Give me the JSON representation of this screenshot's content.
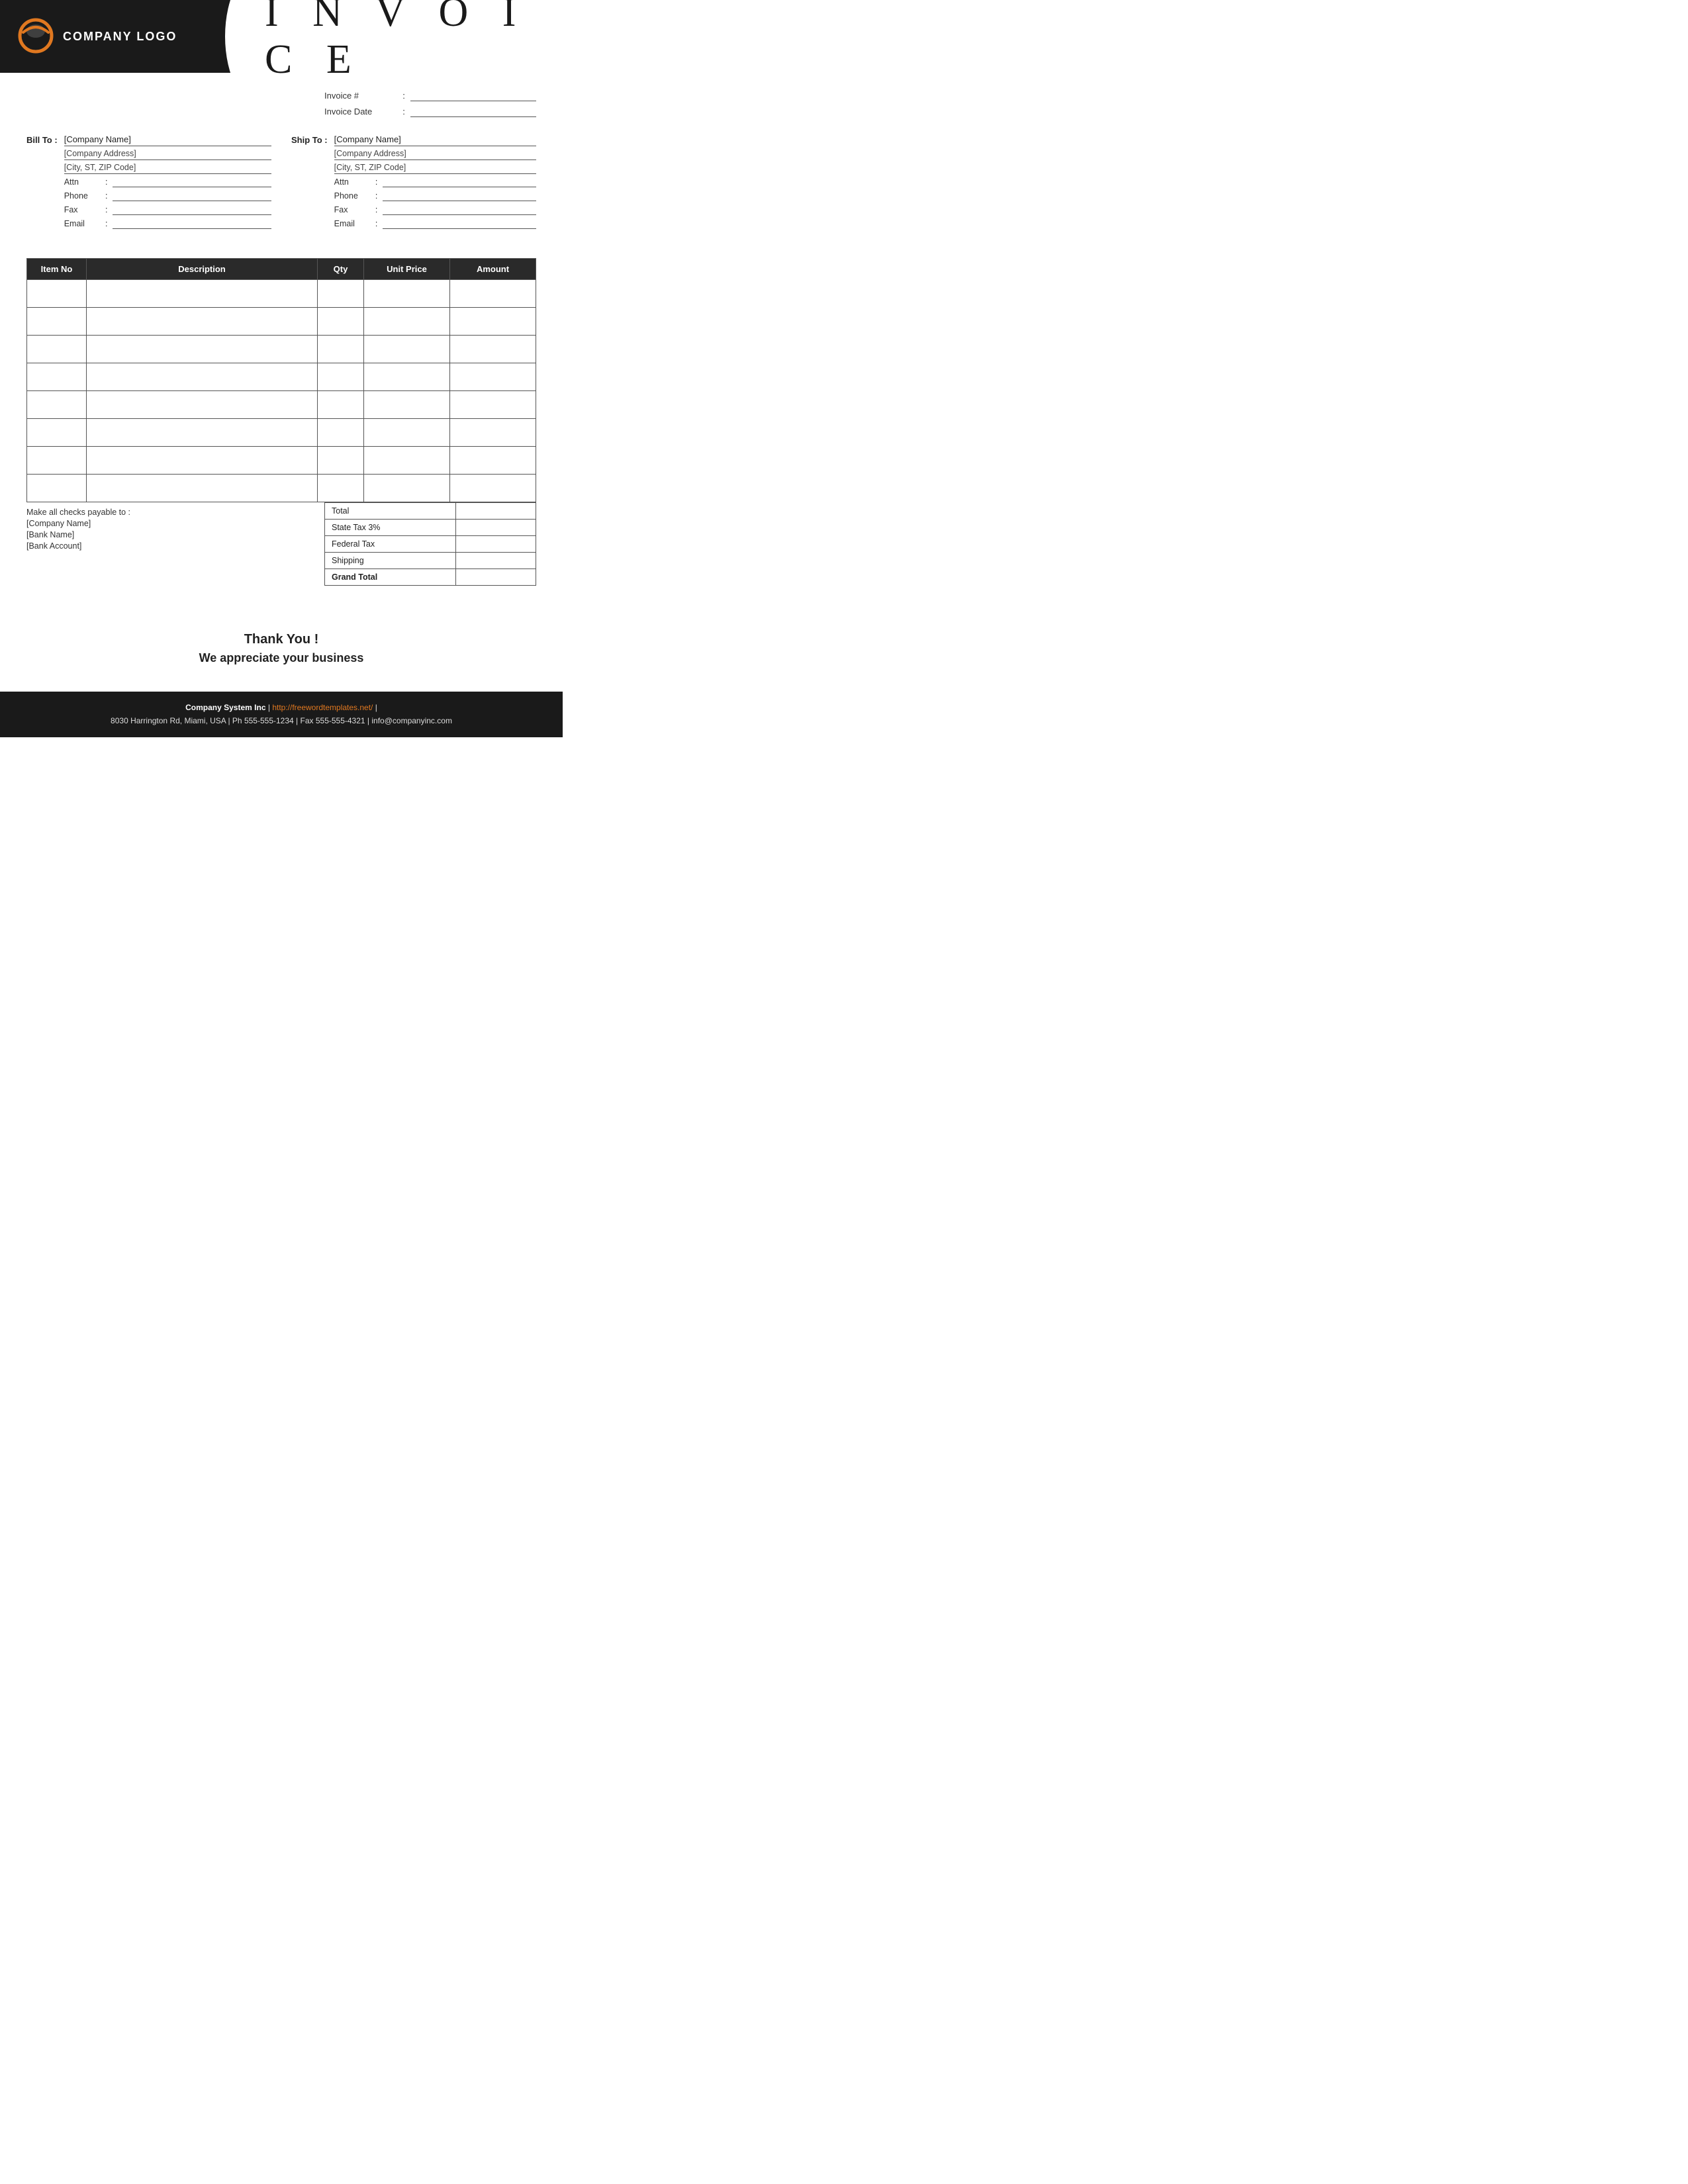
{
  "header": {
    "logo_text": "COMPANY LOGO",
    "title": "I N V O I C E"
  },
  "invoice_meta": {
    "invoice_number_label": "Invoice #",
    "invoice_date_label": "Invoice Date",
    "colon": ":"
  },
  "bill_to": {
    "label": "Bill To :",
    "company_name": "[Company Name]",
    "company_address": "[Company Address]",
    "city_zip": "[City, ST, ZIP Code]",
    "attn_label": "Attn",
    "phone_label": "Phone",
    "fax_label": "Fax",
    "email_label": "Email"
  },
  "ship_to": {
    "label": "Ship To :",
    "company_name": "[Company Name]",
    "company_address": "[Company Address]",
    "city_zip": "[City, ST, ZIP Code]",
    "attn_label": "Attn",
    "phone_label": "Phone",
    "fax_label": "Fax",
    "email_label": "Email"
  },
  "table": {
    "headers": [
      "Item No",
      "Description",
      "Qty",
      "Unit Price",
      "Amount"
    ],
    "rows": [
      {
        "item_no": "",
        "description": "",
        "qty": "",
        "unit_price": "",
        "amount": ""
      },
      {
        "item_no": "",
        "description": "",
        "qty": "",
        "unit_price": "",
        "amount": ""
      },
      {
        "item_no": "",
        "description": "",
        "qty": "",
        "unit_price": "",
        "amount": ""
      },
      {
        "item_no": "",
        "description": "",
        "qty": "",
        "unit_price": "",
        "amount": ""
      },
      {
        "item_no": "",
        "description": "",
        "qty": "",
        "unit_price": "",
        "amount": ""
      },
      {
        "item_no": "",
        "description": "",
        "qty": "",
        "unit_price": "",
        "amount": ""
      },
      {
        "item_no": "",
        "description": "",
        "qty": "",
        "unit_price": "",
        "amount": ""
      },
      {
        "item_no": "",
        "description": "",
        "qty": "",
        "unit_price": "",
        "amount": ""
      }
    ]
  },
  "summary": {
    "total_label": "Total",
    "state_tax_label": "State Tax    3%",
    "federal_tax_label": "Federal Tax",
    "shipping_label": "Shipping",
    "grand_total_label": "Grand Total"
  },
  "checks_info": {
    "line1": "Make all checks payable to :",
    "company": "[Company Name]",
    "bank": "[Bank Name]",
    "account": "[Bank Account]"
  },
  "thank_you": {
    "line1": "Thank You !",
    "line2": "We appreciate your business"
  },
  "footer": {
    "company_name": "Company System Inc",
    "separator1": "|",
    "website_url": "http://freewordtemplates.net/",
    "separator2": "|",
    "address": "8030 Harrington Rd, Miami, USA",
    "phone_label": "Ph",
    "phone": "555-555-1234",
    "fax_label": "Fax",
    "fax": "555-555-4321",
    "email_label": "info@companyinc.com"
  }
}
